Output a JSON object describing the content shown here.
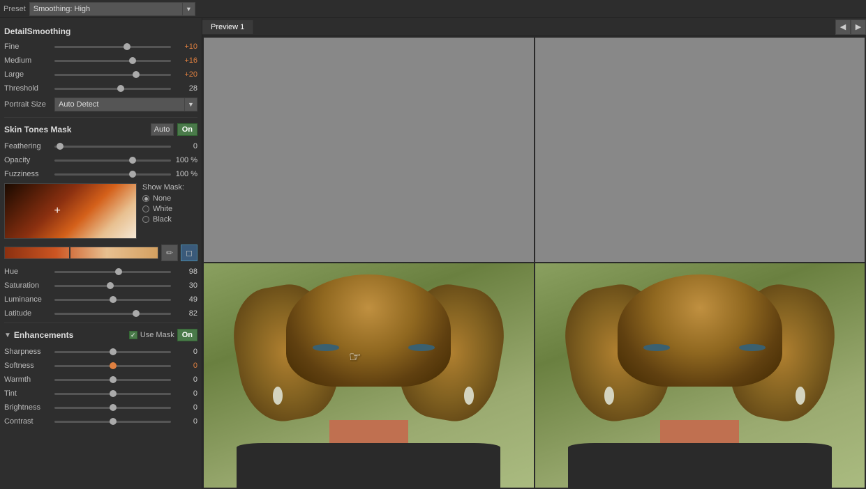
{
  "preset": {
    "label": "Preset",
    "value": "Smoothing: High"
  },
  "detail_smoothing": {
    "title": "DetailSmoothing",
    "sliders": [
      {
        "label": "Fine",
        "value": "+10",
        "thumb_pos": "62%",
        "colored": true
      },
      {
        "label": "Medium",
        "value": "+16",
        "thumb_pos": "67%",
        "colored": true
      },
      {
        "label": "Large",
        "value": "+20",
        "thumb_pos": "70%",
        "colored": true
      },
      {
        "label": "Threshold",
        "value": "28",
        "thumb_pos": "57%",
        "colored": false
      }
    ],
    "portrait_size": {
      "label": "Portrait Size",
      "value": "Auto Detect"
    }
  },
  "skin_tones_mask": {
    "title": "Skin Tones Mask",
    "auto_label": "Auto",
    "on_label": "On",
    "sliders": [
      {
        "label": "Feathering",
        "value": "0",
        "thumb_pos": "5%",
        "colored": false
      },
      {
        "label": "Opacity",
        "value": "100 %",
        "thumb_pos": "67%",
        "colored": false
      },
      {
        "label": "Fuzziness",
        "value": "100 %",
        "thumb_pos": "67%",
        "colored": false
      }
    ],
    "show_mask": {
      "title": "Show Mask:",
      "options": [
        {
          "label": "None",
          "selected": true
        },
        {
          "label": "White",
          "selected": false
        },
        {
          "label": "Black",
          "selected": false
        }
      ]
    },
    "hue_sliders": [
      {
        "label": "Hue",
        "value": "98",
        "thumb_pos": "55%",
        "colored": false
      },
      {
        "label": "Saturation",
        "value": "30",
        "thumb_pos": "48%",
        "colored": false
      },
      {
        "label": "Luminance",
        "value": "49",
        "thumb_pos": "50%",
        "colored": false
      },
      {
        "label": "Latitude",
        "value": "82",
        "thumb_pos": "70%",
        "colored": false
      }
    ]
  },
  "enhancements": {
    "title": "Enhancements",
    "use_mask_label": "Use Mask",
    "on_label": "On",
    "sliders": [
      {
        "label": "Sharpness",
        "value": "0",
        "thumb_pos": "50%",
        "colored": false
      },
      {
        "label": "Softness",
        "value": "0",
        "thumb_pos": "50%",
        "colored": false
      },
      {
        "label": "Warmth",
        "value": "0",
        "thumb_pos": "50%",
        "colored": false
      },
      {
        "label": "Tint",
        "value": "0",
        "thumb_pos": "50%",
        "colored": false
      },
      {
        "label": "Brightness",
        "value": "0",
        "thumb_pos": "50%",
        "colored": false
      },
      {
        "label": "Contrast",
        "value": "0",
        "thumb_pos": "50%",
        "colored": false
      }
    ]
  },
  "preview": {
    "tab_label": "Preview 1",
    "nav_left": "◀",
    "nav_right": "▶"
  },
  "icons": {
    "collapse": "▼",
    "dropdown": "▼",
    "picker": "✏",
    "eraser": "◻",
    "check": "✓",
    "hand_cursor": "☞"
  }
}
